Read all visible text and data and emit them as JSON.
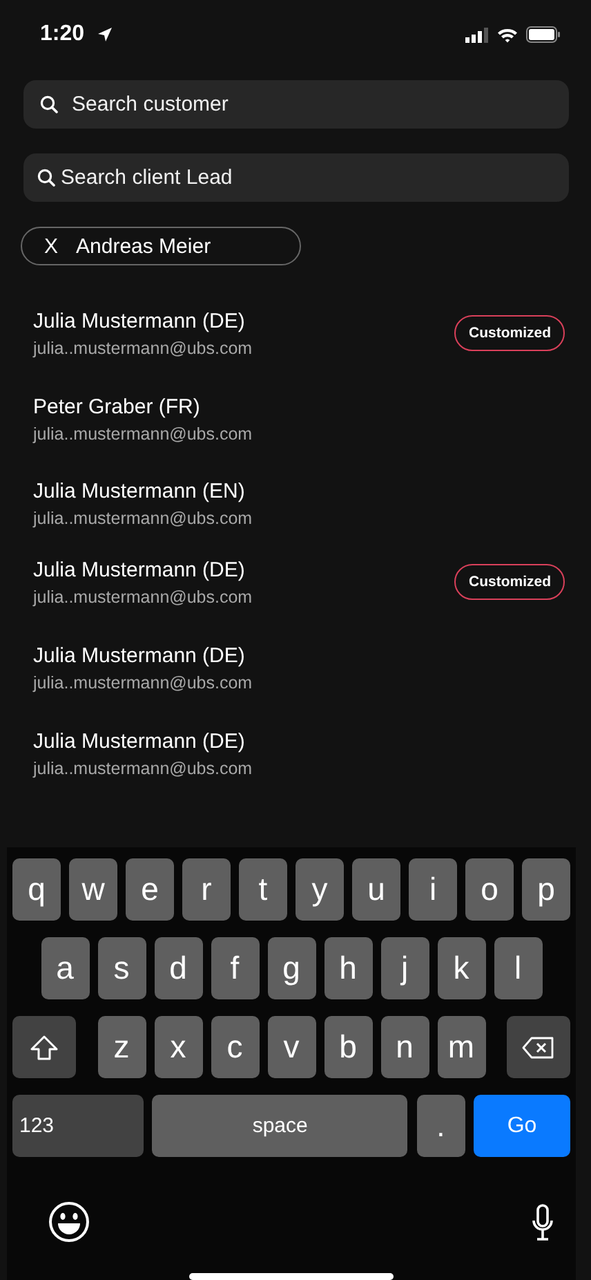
{
  "status_bar": {
    "time": "1:20"
  },
  "searches": [
    {
      "placeholder": "Search customer"
    },
    {
      "placeholder": "Search client Lead"
    }
  ],
  "filter_chip": {
    "remove": "X",
    "label": "Andreas Meier"
  },
  "contacts": [
    {
      "name": "Julia Mustermann (DE)",
      "email": "julia..mustermann@ubs.com",
      "tag": "Customized"
    },
    {
      "name": "Peter Graber (FR)",
      "email": "julia..mustermann@ubs.com"
    },
    {
      "name": "Julia Mustermann (EN)",
      "email": "julia..mustermann@ubs.com"
    },
    {
      "name": "Julia Mustermann (DE)",
      "email": "julia..mustermann@ubs.com",
      "tag": "Customized"
    },
    {
      "name": "Julia Mustermann  (DE)",
      "email": "julia..mustermann@ubs.com"
    },
    {
      "name": "Julia Mustermann  (DE)",
      "email": "julia..mustermann@ubs.com"
    }
  ],
  "keyboard": {
    "rows": [
      [
        "q",
        "w",
        "e",
        "r",
        "t",
        "y",
        "u",
        "i",
        "o",
        "p"
      ],
      [
        "a",
        "s",
        "d",
        "f",
        "g",
        "h",
        "j",
        "k",
        "l"
      ],
      [
        "z",
        "x",
        "c",
        "v",
        "b",
        "n",
        "m"
      ]
    ],
    "bottom": [
      {
        "label": "123",
        "kind": "mode"
      },
      {
        "label": "space",
        "kind": "space"
      },
      {
        "label": ".",
        "kind": "key"
      },
      {
        "label": "Go",
        "kind": "primary"
      }
    ]
  }
}
